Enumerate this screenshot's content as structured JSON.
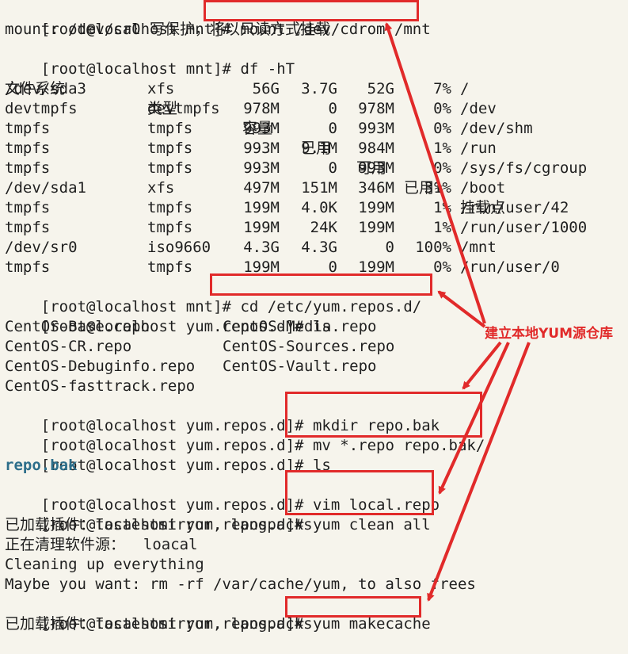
{
  "terminal": {
    "prompt_mnt": "[root@localhost mnt]# ",
    "prompt_repos": "[root@localhost yum.repos.d]# ",
    "cmd_mount": "mount /dev/cdrom /mnt",
    "out_mount": "mount: /dev/sr0 写保护，将以只读方式挂载",
    "cmd_df": "df -hT",
    "df_header": [
      "文件系统",
      "类型",
      "容量",
      "已用",
      "可用",
      "已用%",
      "挂载点"
    ],
    "df_rows": [
      [
        "/dev/sda3",
        "xfs",
        "56G",
        "3.7G",
        "52G",
        "7%",
        "/"
      ],
      [
        "devtmpfs",
        "devtmpfs",
        "978M",
        "0",
        "978M",
        "0%",
        "/dev"
      ],
      [
        "tmpfs",
        "tmpfs",
        "993M",
        "0",
        "993M",
        "0%",
        "/dev/shm"
      ],
      [
        "tmpfs",
        "tmpfs",
        "993M",
        "9.1M",
        "984M",
        "1%",
        "/run"
      ],
      [
        "tmpfs",
        "tmpfs",
        "993M",
        "0",
        "993M",
        "0%",
        "/sys/fs/cgroup"
      ],
      [
        "/dev/sda1",
        "xfs",
        "497M",
        "151M",
        "346M",
        "31%",
        "/boot"
      ],
      [
        "tmpfs",
        "tmpfs",
        "199M",
        "4.0K",
        "199M",
        "1%",
        "/run/user/42"
      ],
      [
        "tmpfs",
        "tmpfs",
        "199M",
        "24K",
        "199M",
        "1%",
        "/run/user/1000"
      ],
      [
        "/dev/sr0",
        "iso9660",
        "4.3G",
        "4.3G",
        "0",
        "100%",
        "/mnt"
      ],
      [
        "tmpfs",
        "tmpfs",
        "199M",
        "0",
        "199M",
        "0%",
        "/run/user/0"
      ]
    ],
    "cmd_cd": "cd /etc/yum.repos.d/",
    "cmd_ls": "ls",
    "ls_files": [
      [
        "CentOS-Base.repo",
        "CentOS-Media.repo"
      ],
      [
        "CentOS-CR.repo",
        "CentOS-Sources.repo"
      ],
      [
        "CentOS-Debuginfo.repo",
        "CentOS-Vault.repo"
      ],
      [
        "CentOS-fasttrack.repo",
        ""
      ]
    ],
    "cmd_mkdir": "mkdir repo.bak",
    "cmd_mv": "mv *.repo repo.bak/",
    "cmd_ls2": "ls",
    "ls2_dir": "repo.bak",
    "cmd_vim": "vim local.repo",
    "cmd_clean": "yum clean all",
    "out_clean_1": "已加载插件：fastestmirror, langpacks",
    "out_clean_2": "正在清理软件源：  loacal",
    "out_clean_3": "Cleaning up everything",
    "out_clean_4": "Maybe you want: rm -rf /var/cache/yum, to also frees",
    "cmd_makecache": "yum makecache",
    "out_makecache_1": "已加载插件：fastestmirror, langpacks"
  },
  "annotation": {
    "label": "建立本地YUM源仓库",
    "color": "#e12a2a"
  }
}
